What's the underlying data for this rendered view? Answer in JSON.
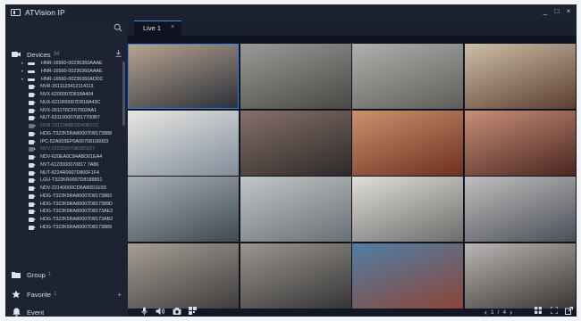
{
  "app": {
    "title": "ATVision IP"
  },
  "window_controls": [
    "_",
    "□",
    "×"
  ],
  "sidebar": {
    "search": {
      "placeholder": ""
    },
    "devices": {
      "label": "Devices",
      "count": "34"
    },
    "group": {
      "label": "Group",
      "count": "1"
    },
    "favorite": {
      "label": "Favorite",
      "count": "1"
    },
    "event": {
      "label": "Event"
    },
    "device_list": [
      {
        "name": "HNR-16560-00236360AAAE",
        "kind": "nvr",
        "expand": "▸",
        "dim": false
      },
      {
        "name": "HNR-16560-00236360AAAE",
        "kind": "nvr",
        "expand": "▸",
        "dim": false
      },
      {
        "name": "HNR-16560-00236360ADDC",
        "kind": "nvr",
        "expand": "▸",
        "dim": false
      },
      {
        "name": "NVR-2611123412114113",
        "kind": "cam",
        "expand": "",
        "dim": false
      },
      {
        "name": "NVX-6200007D818A404",
        "kind": "cam",
        "expand": "",
        "dim": false
      },
      {
        "name": "NUX-6210R0007D818A43C",
        "kind": "cam",
        "expand": "",
        "dim": false
      },
      {
        "name": "NVX-2611T6CF67002AA1",
        "kind": "cam",
        "expand": "",
        "dim": false
      },
      {
        "name": "NUT-6311000070817700B7",
        "kind": "cam",
        "expand": "",
        "dim": false
      },
      {
        "name": "NVR-23110ABE9DA0B31C",
        "kind": "cam",
        "expand": "",
        "dim": true
      },
      {
        "name": "HDG-T322K5RA80007D8173888",
        "kind": "cam",
        "expand": "",
        "dim": false
      },
      {
        "name": "IPC-52A003EP0A00708106003",
        "kind": "cam",
        "expand": "",
        "dim": false
      },
      {
        "name": "NVV-22230007081B5157",
        "kind": "cam",
        "expand": "",
        "dim": true
      },
      {
        "name": "NDV-620EA0C84ABD01EA4",
        "kind": "cam",
        "expand": "",
        "dim": false
      },
      {
        "name": "NVT-6123000070817 7A86",
        "kind": "cam",
        "expand": "",
        "dim": false
      },
      {
        "name": "NUT-8224R0007D800F1F4",
        "kind": "cam",
        "expand": "",
        "dim": false
      },
      {
        "name": "LGU-T322KR0007D8188851",
        "kind": "cam",
        "expand": "",
        "dim": false
      },
      {
        "name": "NDV-22140000CD6A80D1E93",
        "kind": "cam",
        "expand": "",
        "dim": false
      },
      {
        "name": "HDG-T322K5RA80007D8173883",
        "kind": "cam",
        "expand": "",
        "dim": false
      },
      {
        "name": "HDG-T322K5RA80007D817389D",
        "kind": "cam",
        "expand": "",
        "dim": false
      },
      {
        "name": "HDG-T322K5RA80007D8173AE2",
        "kind": "cam",
        "expand": "",
        "dim": false
      },
      {
        "name": "HDG-T322K5RA80007D8173AB2",
        "kind": "cam",
        "expand": "",
        "dim": false
      },
      {
        "name": "HDG-T322K5RA80007D8173889",
        "kind": "cam",
        "expand": "",
        "dim": false
      }
    ]
  },
  "tabs": [
    {
      "label": "Live 1",
      "close": "×"
    }
  ],
  "tiles": [
    {
      "name": "tile-railway-yard",
      "colors": [
        "#b9a592",
        "#2a2f37"
      ],
      "selected": true
    },
    {
      "name": "tile-empty-room",
      "colors": [
        "#9c9a96",
        "#4a4845"
      ],
      "selected": false
    },
    {
      "name": "tile-corridor",
      "colors": [
        "#afafab",
        "#5d5d5a"
      ],
      "selected": false
    },
    {
      "name": "tile-library",
      "colors": [
        "#cdbfa8",
        "#5c3e2f"
      ],
      "selected": false
    },
    {
      "name": "tile-office-meeting",
      "colors": [
        "#e8e6e3",
        "#7f8d99"
      ],
      "selected": false
    },
    {
      "name": "tile-restaurant",
      "colors": [
        "#86706a",
        "#2d2a28"
      ],
      "selected": false
    },
    {
      "name": "tile-food-court",
      "colors": [
        "#c9926e",
        "#6f3020"
      ],
      "selected": false
    },
    {
      "name": "tile-dining-hall",
      "colors": [
        "#c78f77",
        "#4a2620"
      ],
      "selected": false
    },
    {
      "name": "tile-airport-terminal-a",
      "colors": [
        "#aab0b4",
        "#3f4a53"
      ],
      "selected": false
    },
    {
      "name": "tile-airport-terminal-b",
      "colors": [
        "#c3c6c8",
        "#6a6f73"
      ],
      "selected": false
    },
    {
      "name": "tile-office-desk",
      "colors": [
        "#e0ded9",
        "#6e6c69"
      ],
      "selected": false
    },
    {
      "name": "tile-airport-hall",
      "colors": [
        "#bfbfbe",
        "#4b4f57"
      ],
      "selected": false
    },
    {
      "name": "tile-highway-a",
      "colors": [
        "#a79e95",
        "#3e3d3c"
      ],
      "selected": false
    },
    {
      "name": "tile-highway-b",
      "colors": [
        "#9b958f",
        "#363636"
      ],
      "selected": false
    },
    {
      "name": "tile-departure-board",
      "colors": [
        "#4f7fa6",
        "#8c4538"
      ],
      "selected": false
    },
    {
      "name": "tile-computer-lab",
      "colors": [
        "#b9b6b3",
        "#3a3632"
      ],
      "selected": false
    }
  ],
  "toolbar": {
    "left_icons": [
      "microphone-icon",
      "speaker-icon",
      "snapshot-icon",
      "layout-icon"
    ],
    "page_current": "1",
    "page_sep": "/",
    "page_total": "4",
    "prev": "‹",
    "next": "›"
  }
}
